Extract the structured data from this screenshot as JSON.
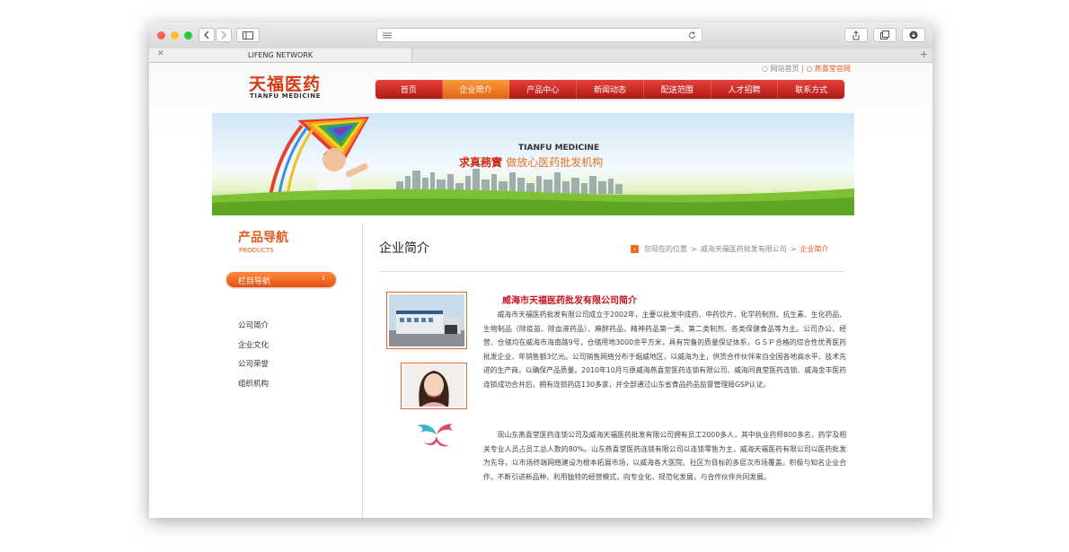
{
  "browser": {
    "tab_title": "LIFENG NETWORK",
    "tab_close": "✕",
    "new_tab": "+"
  },
  "site": {
    "logo_cn": "天福医药",
    "logo_en": "TIANFU MEDICINE",
    "toplinks": {
      "home": "网站首页",
      "brand": "燕喜堂官网"
    },
    "nav": [
      "首页",
      "企业简介",
      "产品中心",
      "新闻动态",
      "配送范围",
      "人才招聘",
      "联系方式"
    ],
    "nav_active_index": 1,
    "banner": {
      "en": "TIANFU MEDICINE",
      "cn_main": "求真務實",
      "cn_sub": "做放心医药批发机构"
    },
    "left_nav": {
      "title": "产品导航",
      "subtitle": "PRODUCTS",
      "bar_label": "栏目导航",
      "bar_arrow": "›",
      "items": [
        "公司简介",
        "企业文化",
        "公司荣誉",
        "组织机构"
      ]
    },
    "main": {
      "title": "企业简介",
      "breadcrumb": {
        "icon": "›",
        "prefix": "您现在的位置",
        "sep": ">",
        "company": "威海天福医药批发有限公司",
        "current": "企业简介"
      },
      "article_title": "威海市天福医药批发有限公司简介",
      "paragraph1": "威海市天福医药批发有限公司成立于2002年，主要以批发中成药、中药饮片、化学药制剂、抗生素、生化药品、生物制品（除疫苗、除血液药品）、麻醉药品、精神药品第一类、第二类制剂、各类保健食品等为主。公司办公、经营、仓储均在威海市海南路9号，仓储用地3000余平方米，具有完备的质量保证体系，ＧＳＰ合格的综合性优秀医药批发企业，年销售额3亿元。公司销售网络分布于烟威地区，以威海为主，供货合作伙伴来自全国各地高水平、技术先进的生产商。以确保产品质量。2010年10月与原威海燕喜堂医药连锁有限公司、威海同真堂医药连锁、威海金丰医药连锁成功合并后，拥有连锁药店130多家，并全部通过山东省食品药品监督管理局GSP认证。",
      "paragraph2": "现山东燕喜堂医药连锁公司及威海天福医药批发有限公司拥有员工2000多人，其中执业药师800多名，药学及相关专业人员占员工总人数的80%。山东燕喜堂医药连锁有限公司以连锁零售为主，威海天福医药有限公司以医药批发为先导，以市场终端网络建设为根本拓展市场，以威海各大医院、社区为目标的多层次市场覆盖。积极与知名企业合作，不断引进新品种，利用独特的经营模式，向专业化，规范化发展，与合作伙伴共同发展。"
    }
  },
  "colors": {
    "nav_red": "#c8241b",
    "nav_active": "#f07a22",
    "accent_orange": "#e05a20",
    "title_red": "#c8141f"
  }
}
